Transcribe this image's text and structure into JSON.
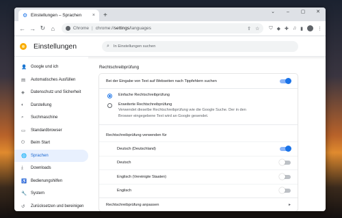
{
  "browser": {
    "tab_title": "Einstellungen – Sprachen",
    "tab_close": "×",
    "new_tab": "+",
    "window_controls": [
      "⌄",
      "–",
      "▢",
      "✕"
    ],
    "omnibox": {
      "chip": "Chrome",
      "url_prefix": "chrome://",
      "url_strong": "settings",
      "url_suffix": "/languages"
    }
  },
  "settings": {
    "title": "Einstellungen",
    "search_placeholder": "In Einstellungen suchen",
    "sidebar": [
      {
        "label": "Google und ich",
        "icon": "person-icon",
        "glyph": "👤",
        "active": false
      },
      {
        "label": "Automatisches Ausfüllen",
        "icon": "clipboard-icon",
        "glyph": "▤",
        "active": false
      },
      {
        "label": "Datenschutz und Sicherheit",
        "icon": "shield-icon",
        "glyph": "◈",
        "active": false
      },
      {
        "label": "Darstellung",
        "icon": "palette-icon",
        "glyph": "◐",
        "active": false
      },
      {
        "label": "Suchmaschine",
        "icon": "search-icon",
        "glyph": "⌕",
        "active": false
      },
      {
        "label": "Standardbrowser",
        "icon": "browser-icon",
        "glyph": "▭",
        "active": false
      },
      {
        "label": "Beim Start",
        "icon": "power-icon",
        "glyph": "⏻",
        "active": false
      },
      {
        "label": "Sprachen",
        "icon": "globe-icon",
        "glyph": "🌐",
        "active": true
      },
      {
        "label": "Downloads",
        "icon": "download-icon",
        "glyph": "⤓",
        "active": false
      },
      {
        "label": "Bedienungshilfen",
        "icon": "accessibility-icon",
        "glyph": "♿",
        "active": false
      },
      {
        "label": "System",
        "icon": "wrench-icon",
        "glyph": "🔧",
        "active": false
      },
      {
        "label": "Zurücksetzen und bereinigen",
        "icon": "reset-icon",
        "glyph": "↺",
        "active": false
      }
    ],
    "spellcheck": {
      "section_title": "Rechtschreibprüfung",
      "main_toggle_label": "Bei der Eingabe von Text auf Webseiten nach Tippfehlern suchen",
      "main_toggle_on": true,
      "option_basic": "Einfache Rechtschreibprüfung",
      "option_enhanced": "Erweiterte Rechtschreibprüfung",
      "option_enhanced_desc_1": "Verwendet dieselbe Rechtschreibprüfung wie die Google Suche. Der in den",
      "option_enhanced_desc_2": "Browser eingegebene Text wird an Google gesendet.",
      "selected_option": "basic",
      "languages_label": "Rechtschreibprüfung verwenden für",
      "languages": [
        {
          "label": "Deutsch (Deutschland)",
          "on": true
        },
        {
          "label": "Deutsch",
          "on": false
        },
        {
          "label": "Englisch (Vereinigte Staaten)",
          "on": false
        },
        {
          "label": "Englisch",
          "on": false
        }
      ],
      "customize_label": "Rechtschreibprüfung anpassen",
      "customize_chevron": "▸"
    }
  },
  "colors": {
    "accent": "#1a73e8",
    "active_nav_bg": "#e8f0fe"
  }
}
